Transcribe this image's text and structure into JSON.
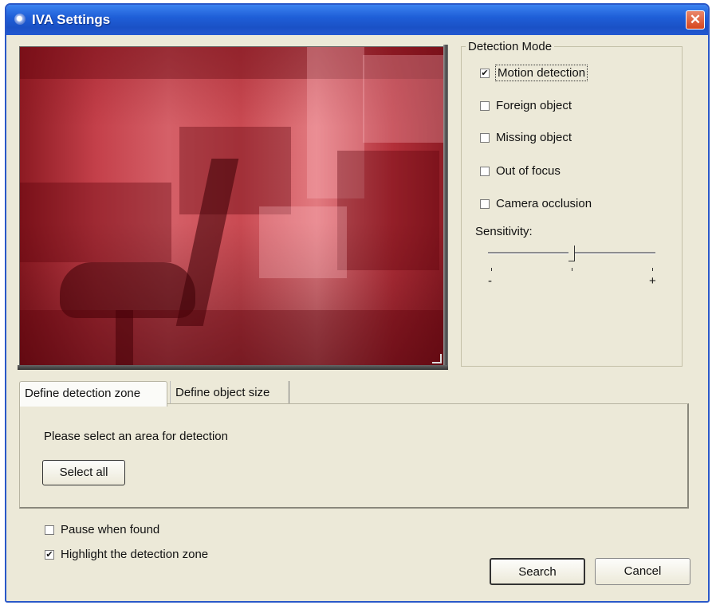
{
  "window": {
    "title": "IVA Settings",
    "close_glyph": "✕"
  },
  "detection_mode": {
    "legend": "Detection Mode",
    "options": [
      {
        "label": "Motion detection",
        "checked": true
      },
      {
        "label": "Foreign object",
        "checked": false
      },
      {
        "label": "Missing object",
        "checked": false
      },
      {
        "label": "Out of focus",
        "checked": false
      },
      {
        "label": "Camera occlusion",
        "checked": false
      }
    ],
    "sensitivity": {
      "label": "Sensitivity:",
      "min_label": "-",
      "max_label": "+",
      "value_fraction": 0.5
    }
  },
  "tabs": [
    {
      "label": "Define detection zone",
      "active": true
    },
    {
      "label": "Define object size",
      "active": false
    }
  ],
  "panel": {
    "instruction": "Please select an area for detection",
    "select_all_label": "Select all"
  },
  "options": {
    "pause_when_found": {
      "label": "Pause when found",
      "checked": false
    },
    "highlight_zone": {
      "label": "Highlight the detection zone",
      "checked": true
    }
  },
  "buttons": {
    "search_label": "Search",
    "cancel_label": "Cancel"
  },
  "check_glyph": "✔",
  "colors": {
    "title_bar": "#1f5fd8",
    "detection_overlay": "#c4404a",
    "dialog_bg": "#ece9d8"
  }
}
